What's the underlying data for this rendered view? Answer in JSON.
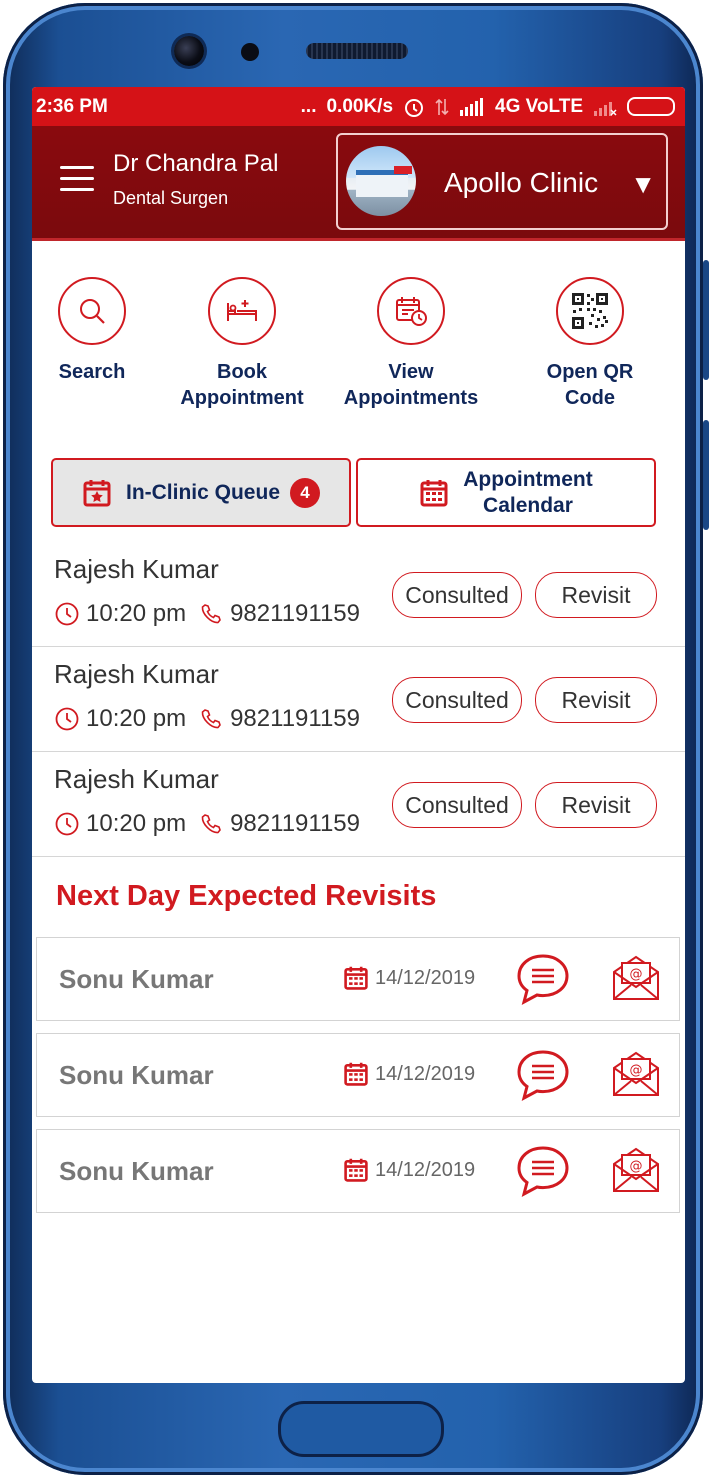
{
  "status_bar": {
    "time": "2:36 PM",
    "dots": "...",
    "speed": "0.00K/s",
    "network": "4G VoLTE"
  },
  "header": {
    "doctor_name": "Dr Chandra Pal",
    "specialty": "Dental Surgen",
    "clinic_name": "Apollo Clinic"
  },
  "quick_actions": {
    "search": "Search",
    "book_1": "Book",
    "book_2": "Appointment",
    "view_1": "View",
    "view_2": "Appointments",
    "qr_1": "Open QR",
    "qr_2": "Code"
  },
  "tabs": {
    "queue_label": "In-Clinic Queue",
    "queue_count": "4",
    "calendar_1": "Appointment",
    "calendar_2": "Calendar"
  },
  "queue": [
    {
      "name": "Rajesh Kumar",
      "time": "10:20 pm",
      "phone": "9821191159",
      "consulted": "Consulted",
      "revisit": "Revisit"
    },
    {
      "name": "Rajesh Kumar",
      "time": "10:20 pm",
      "phone": "9821191159",
      "consulted": "Consulted",
      "revisit": "Revisit"
    },
    {
      "name": "Rajesh Kumar",
      "time": "10:20 pm",
      "phone": "9821191159",
      "consulted": "Consulted",
      "revisit": "Revisit"
    }
  ],
  "revisits_title": "Next Day Expected Revisits",
  "revisits": [
    {
      "name": "Sonu Kumar",
      "date": "14/12/2019"
    },
    {
      "name": "Sonu Kumar",
      "date": "14/12/2019"
    },
    {
      "name": "Sonu Kumar",
      "date": "14/12/2019"
    }
  ],
  "colors": {
    "brand_red": "#d11a20",
    "header_red": "#7a0a0d",
    "navy": "#10275a",
    "status_red": "#d51217"
  },
  "icons": [
    "menu-icon",
    "search-icon",
    "bed-icon",
    "calendar-clock-icon",
    "qr-code-icon",
    "calendar-star-icon",
    "calendar-icon",
    "clock-icon",
    "phone-icon",
    "chat-icon",
    "mail-icon",
    "alarm-icon",
    "battery-icon",
    "signal-icon",
    "dropdown-caret-icon"
  ]
}
